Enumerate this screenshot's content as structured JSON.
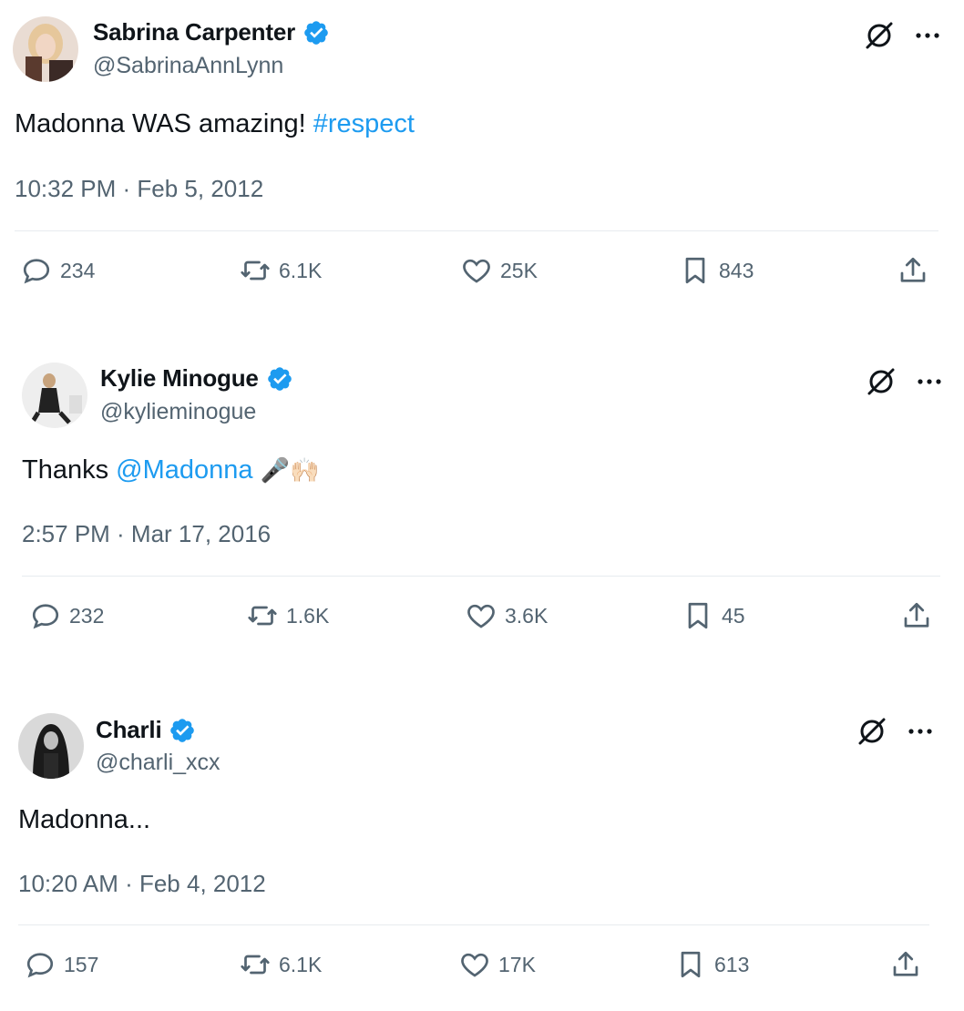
{
  "tweets": [
    {
      "name": "Sabrina Carpenter",
      "handle": "@SabrinaAnnLynn",
      "text": "Madonna WAS amazing! ",
      "link": "#respect",
      "emoji": "",
      "time": "10:32 PM · Feb 5, 2012",
      "replies": "234",
      "reposts": "6.1K",
      "likes": "25K",
      "bookmarks": "843"
    },
    {
      "name": "Kylie Minogue",
      "handle": "@kylieminogue",
      "text": "Thanks ",
      "link": "@Madonna",
      "emoji": " 🎤🙌🏻",
      "time": "2:57 PM · Mar 17, 2016",
      "replies": "232",
      "reposts": "1.6K",
      "likes": "3.6K",
      "bookmarks": "45"
    },
    {
      "name": "Charli",
      "handle": "@charli_xcx",
      "text": "Madonna...",
      "link": "",
      "emoji": "",
      "time": "10:20 AM · Feb 4, 2012",
      "replies": "157",
      "reposts": "6.1K",
      "likes": "17K",
      "bookmarks": "613"
    }
  ],
  "icons": {
    "verified": "verified-badge-icon",
    "grok": "grok-icon",
    "more": "more-options-icon",
    "reply": "reply-icon",
    "repost": "repost-icon",
    "like": "like-icon",
    "bookmark": "bookmark-icon",
    "share": "share-icon"
  },
  "colors": {
    "link": "#1d9bf0",
    "verified": "#1d9bf0",
    "secondary_text": "#536471"
  }
}
